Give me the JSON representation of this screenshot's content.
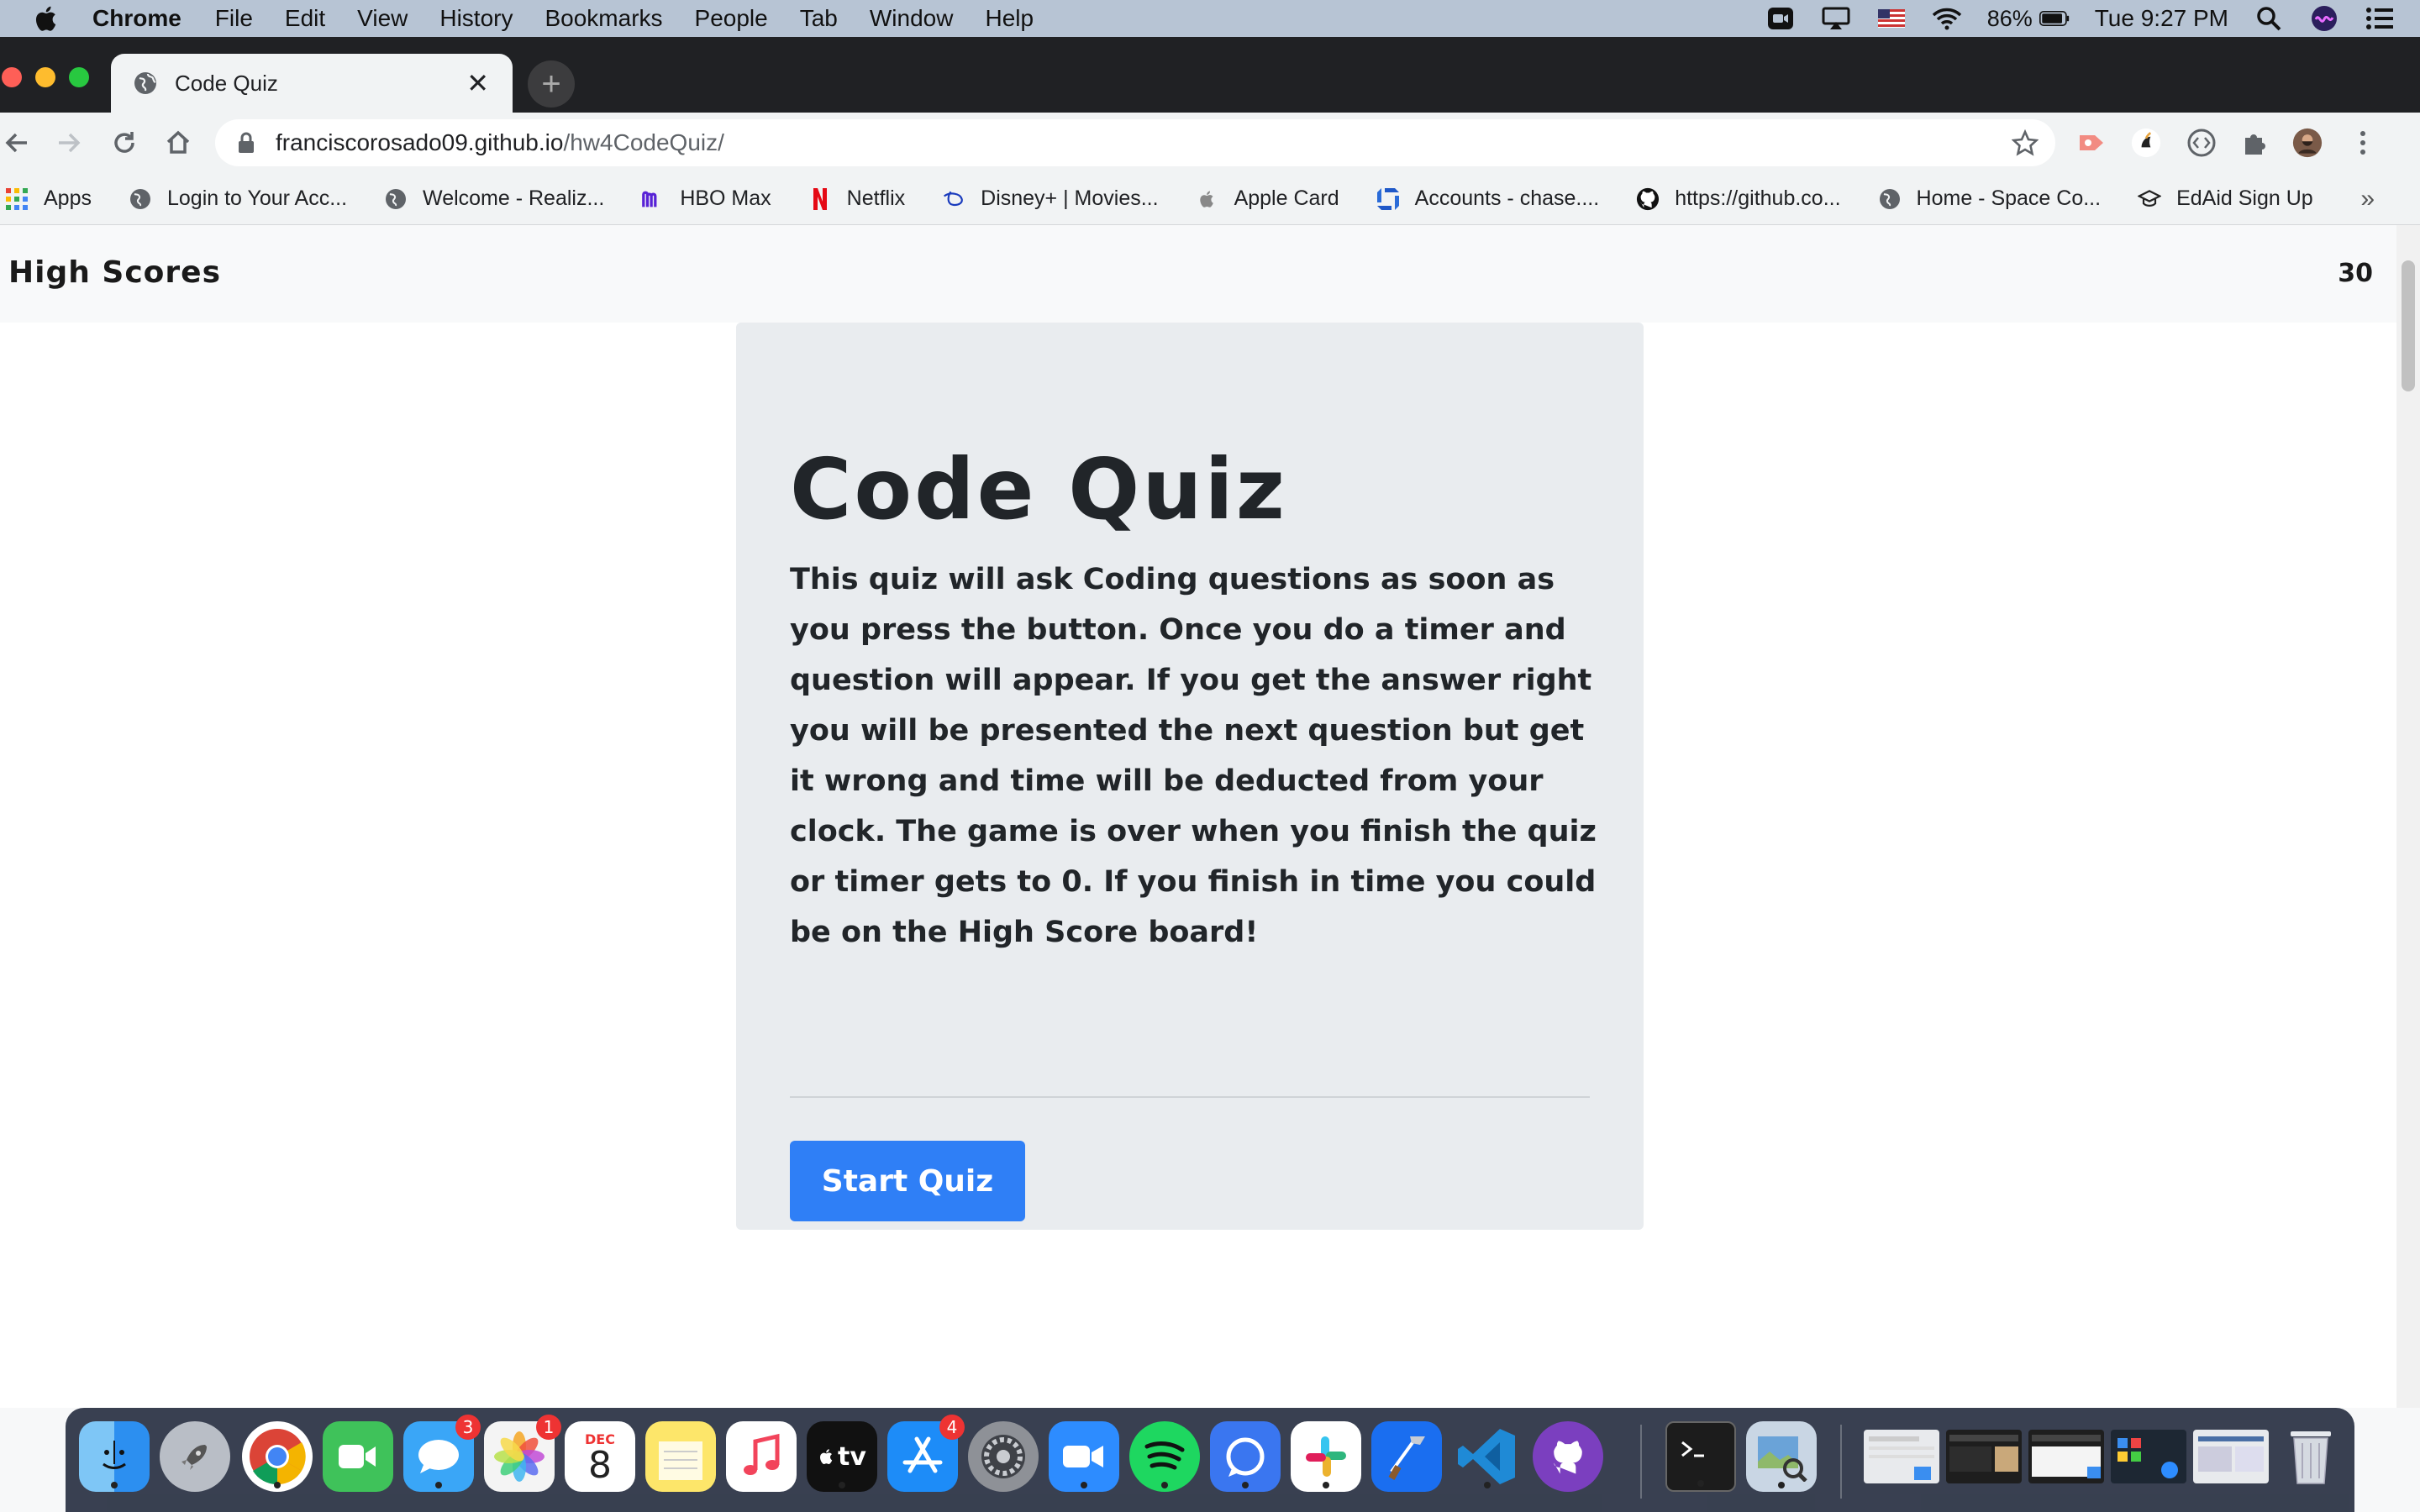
{
  "menubar": {
    "app_name": "Chrome",
    "items": [
      "File",
      "Edit",
      "View",
      "History",
      "Bookmarks",
      "People",
      "Tab",
      "Window",
      "Help"
    ],
    "battery": "86%",
    "clock": "Tue 9:27 PM"
  },
  "browser": {
    "tab_title": "Code Quiz",
    "url_host": "franciscorosado09.github.io",
    "url_path": "/hw4CodeQuiz/",
    "bookmarks": [
      {
        "label": "Apps",
        "icon": "apps-grid-icon"
      },
      {
        "label": "Login to Your Acc...",
        "icon": "globe-icon"
      },
      {
        "label": "Welcome - Realiz...",
        "icon": "globe-icon"
      },
      {
        "label": "HBO Max",
        "icon": "hbo-max-icon"
      },
      {
        "label": "Netflix",
        "icon": "netflix-icon"
      },
      {
        "label": "Disney+ | Movies...",
        "icon": "disney-plus-icon"
      },
      {
        "label": "Apple Card",
        "icon": "apple-icon"
      },
      {
        "label": "Accounts - chase....",
        "icon": "chase-icon"
      },
      {
        "label": "https://github.co...",
        "icon": "github-icon"
      },
      {
        "label": "Home - Space Co...",
        "icon": "globe-icon"
      },
      {
        "label": "EdAid Sign Up",
        "icon": "graduation-cap-icon"
      }
    ],
    "bookmarks_overflow": "»"
  },
  "page": {
    "navbar": {
      "high_scores_link": "High Scores",
      "timer": "30"
    },
    "jumbotron": {
      "title": "Code Quiz",
      "description": "This quiz will ask Coding questions as soon as you press the button. Once you do a timer and question will appear. If you get the answer right you will be presented the next question but get it wrong and time will be deducted from your clock. The game is over when you finish the quiz or timer gets to 0. If you finish in time you could be on the High Score board!",
      "start_button": "Start Quiz"
    }
  },
  "dock": {
    "messages_badge": "3",
    "photos_badge": "1",
    "appstore_badge": "4",
    "calendar_month": "DEC",
    "calendar_day": "8",
    "appletv_label": "tv"
  }
}
